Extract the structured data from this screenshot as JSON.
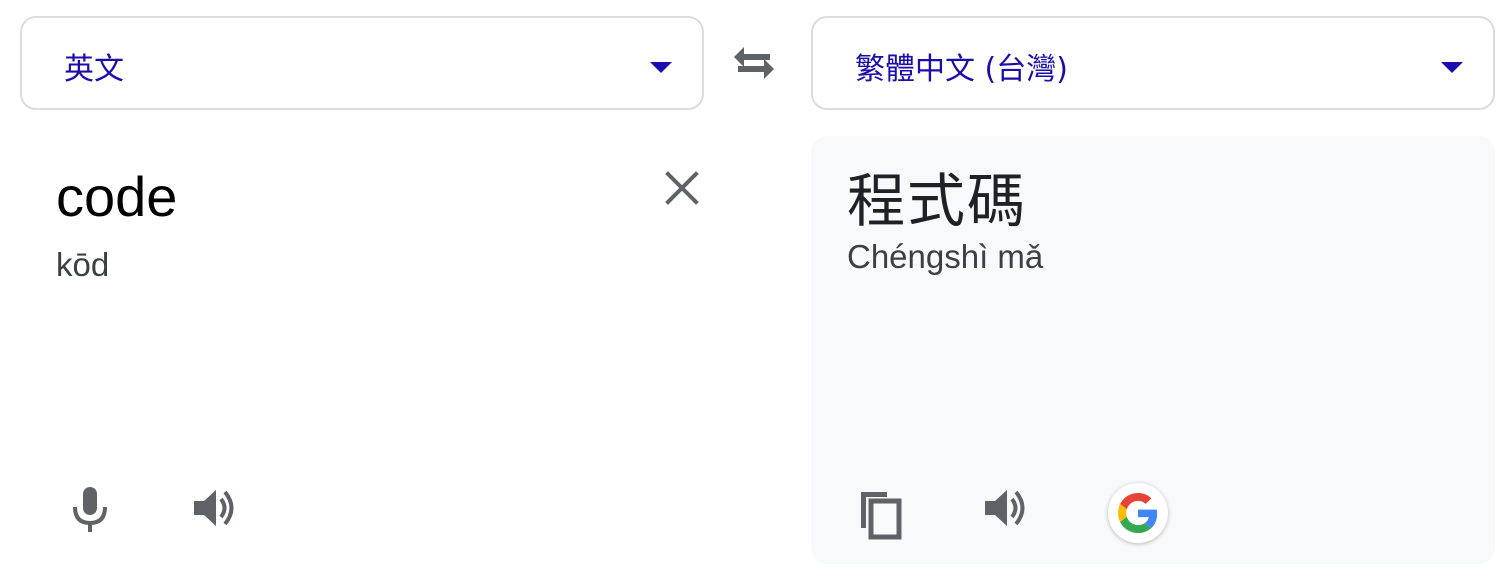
{
  "source_language": {
    "label": "英文"
  },
  "target_language": {
    "label": "繁體中文 (台灣)"
  },
  "source": {
    "text": "code",
    "romanization": "kōd"
  },
  "target": {
    "text": "程式碼",
    "romanization": "Chéngshì mǎ"
  },
  "icons": {
    "swap": "swap-arrows-icon",
    "dropdown": "triangle-down-icon",
    "clear": "close-icon",
    "microphone": "microphone-icon",
    "speaker": "speaker-icon",
    "copy": "copy-icon",
    "google": "google-g-icon"
  },
  "colors": {
    "language_label": "#1a0dab",
    "icon_gray": "#5f6368",
    "target_panel_bg": "#f8f9fa",
    "border": "#dadce0"
  }
}
